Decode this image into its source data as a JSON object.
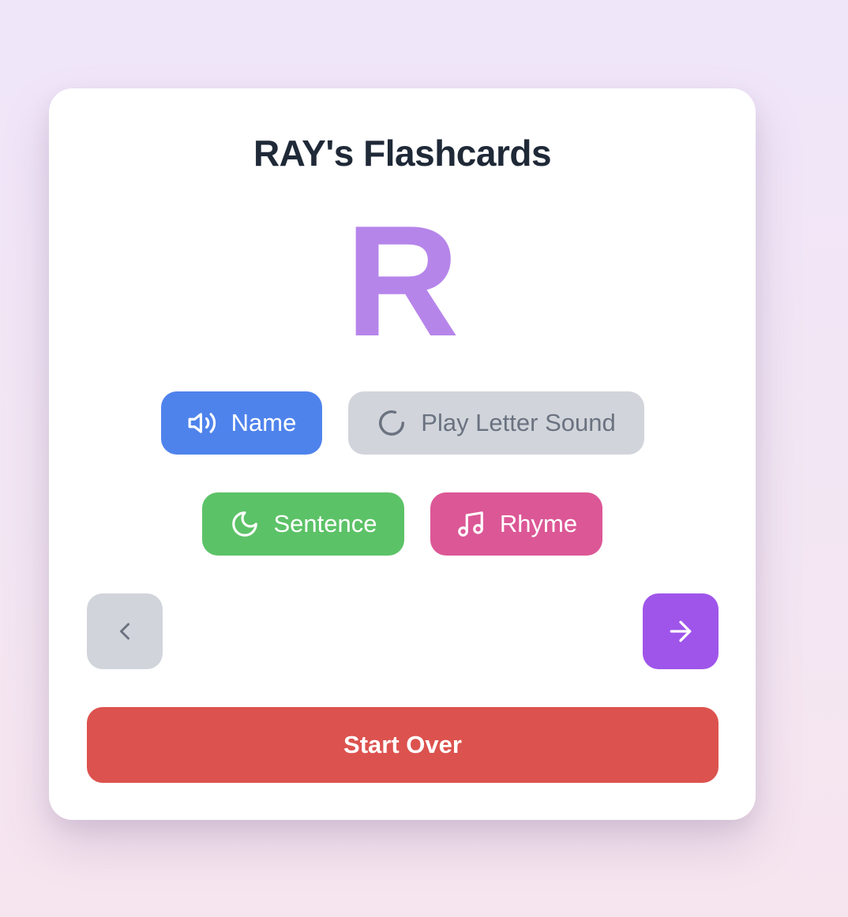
{
  "app": {
    "title": "RAY's Flashcards"
  },
  "card": {
    "letter": "R",
    "letter_color": "#b685ea"
  },
  "buttons": {
    "name": {
      "label": "Name",
      "icon": "speaker-icon",
      "color": "#4f83ec"
    },
    "sound": {
      "label": "Play Letter Sound",
      "icon": "loading-spinner-icon",
      "color": "#d1d5db",
      "state": "loading"
    },
    "sentence": {
      "label": "Sentence",
      "icon": "moon-icon",
      "color": "#5cc267"
    },
    "rhyme": {
      "label": "Rhyme",
      "icon": "music-note-icon",
      "color": "#dc5796"
    }
  },
  "navigation": {
    "prev": {
      "icon": "chevron-left-icon",
      "color": "#d1d5db"
    },
    "next": {
      "icon": "arrow-right-icon",
      "color": "#9f55ea"
    }
  },
  "actions": {
    "start_over_label": "Start Over",
    "start_over_color": "#dc524e"
  }
}
